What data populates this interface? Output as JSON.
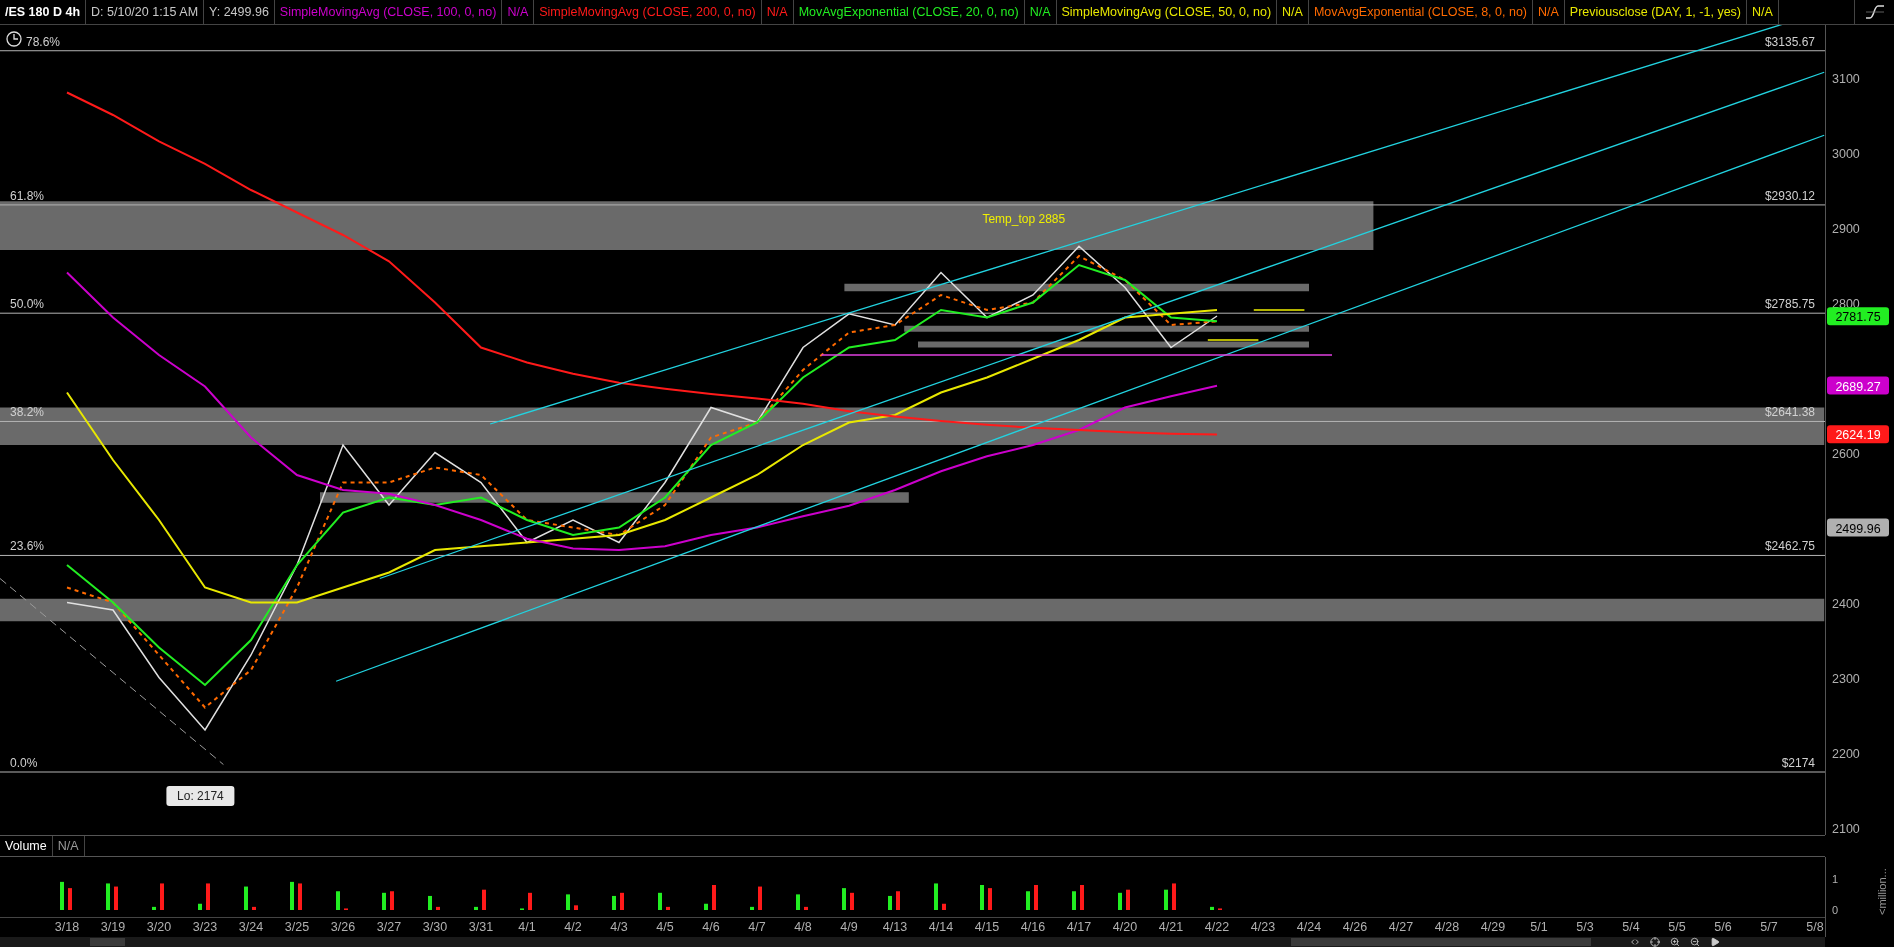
{
  "header": {
    "items": [
      {
        "kind": "symbol",
        "text": "/ES 180 D 4h"
      },
      {
        "kind": "info",
        "text": "D: 5/10/20 1:15 AM"
      },
      {
        "kind": "info",
        "text": "Y: 2499.96"
      },
      {
        "kind": "study",
        "text": "SimpleMovingAvg (CLOSE, 100, 0, no)",
        "color": "#cc00cc"
      },
      {
        "kind": "study",
        "text": "N/A",
        "color": "#cc00cc"
      },
      {
        "kind": "study",
        "text": "SimpleMovingAvg (CLOSE, 200, 0, no)",
        "color": "#ff1a1a"
      },
      {
        "kind": "study",
        "text": "N/A",
        "color": "#ff1a1a"
      },
      {
        "kind": "study",
        "text": "MovAvgExponential (CLOSE, 20, 0, no)",
        "color": "#22ee22"
      },
      {
        "kind": "study",
        "text": "N/A",
        "color": "#22ee22"
      },
      {
        "kind": "study",
        "text": "SimpleMovingAvg (CLOSE, 50, 0, no)",
        "color": "#e8e800"
      },
      {
        "kind": "study",
        "text": "N/A",
        "color": "#e8e800"
      },
      {
        "kind": "study",
        "text": "MovAvgExponential (CLOSE, 8, 0, no)",
        "color": "#ff6a00"
      },
      {
        "kind": "study",
        "text": "N/A",
        "color": "#ff6a00"
      },
      {
        "kind": "study",
        "text": "Previousclose (DAY, 1, -1, yes)",
        "color": "#e8e800"
      },
      {
        "kind": "study",
        "text": "N/A",
        "color": "#e8e800"
      }
    ]
  },
  "price_chart": {
    "levels": [
      {
        "left_label": "78.6%",
        "right_label": "$3135.67"
      },
      {
        "left_label": "61.8%",
        "right_label": "$2930.12"
      },
      {
        "left_label": "50.0%",
        "right_label": "$2785.75"
      },
      {
        "left_label": "38.2%",
        "right_label": "$2641.38"
      },
      {
        "left_label": "23.6%",
        "right_label": "$2462.75"
      },
      {
        "left_label": "0.0%",
        "right_label": "$2174"
      }
    ],
    "notes": [
      {
        "kind": "note",
        "text": "Temp_top 2885"
      },
      {
        "kind": "callout",
        "text": "Lo: 2174"
      }
    ],
    "price_tags": [
      {
        "text": "2781.75",
        "color": "#22ee22"
      },
      {
        "text": "2689.27",
        "color": "#cc00cc"
      },
      {
        "text": "2624.19",
        "color": "#ff1a1a"
      },
      {
        "text": "2499.96",
        "color": "#b0b0b0"
      }
    ],
    "chart_data": {
      "type": "line",
      "x": [
        "3/18",
        "3/19",
        "3/20",
        "3/23",
        "3/24",
        "3/25",
        "3/26",
        "3/27",
        "3/30",
        "3/31",
        "4/1",
        "4/2",
        "4/3",
        "4/5",
        "4/6",
        "4/7",
        "4/8",
        "4/9",
        "4/13",
        "4/14",
        "4/15",
        "4/16",
        "4/17",
        "4/20",
        "4/21",
        "4/22",
        "4/23",
        "4/24",
        "4/26",
        "4/27",
        "4/28",
        "4/29",
        "5/1",
        "5/3",
        "5/4",
        "5/5",
        "5/6",
        "5/7",
        "5/8"
      ],
      "ylim": [
        2090,
        3170
      ],
      "yticks": [
        2100,
        2200,
        2300,
        2400,
        2600,
        2800,
        2900,
        3000,
        3100
      ],
      "series": [
        {
          "color": "#e0e0e0",
          "values": [
            2400,
            2390,
            2300,
            2230,
            2330,
            2450,
            2610,
            2530,
            2600,
            2560,
            2480,
            2510,
            2480,
            2560,
            2660,
            2640,
            2740,
            2785,
            2770,
            2840,
            2780,
            2810,
            2875,
            2820,
            2740,
            2782,
            null,
            null,
            null,
            null,
            null,
            null,
            null,
            null,
            null,
            null,
            null,
            null,
            null
          ]
        },
        {
          "color": "#ff6a00",
          "line_style": "dashed",
          "values": [
            2420,
            2400,
            2330,
            2260,
            2310,
            2420,
            2560,
            2560,
            2580,
            2570,
            2510,
            2500,
            2490,
            2530,
            2620,
            2640,
            2710,
            2760,
            2770,
            2810,
            2790,
            2800,
            2862,
            2830,
            2770,
            2775,
            null,
            null,
            null,
            null,
            null,
            null,
            null,
            null,
            null,
            null,
            null,
            null,
            null
          ]
        },
        {
          "color": "#22ee22",
          "values": [
            2450,
            2400,
            2340,
            2290,
            2350,
            2450,
            2520,
            2540,
            2530,
            2540,
            2510,
            2490,
            2500,
            2540,
            2610,
            2640,
            2700,
            2740,
            2750,
            2790,
            2780,
            2800,
            2850,
            2830,
            2780,
            2775,
            null,
            null,
            null,
            null,
            null,
            null,
            null,
            null,
            null,
            null,
            null,
            null,
            null
          ]
        },
        {
          "color": "#e8e800",
          "values": [
            2680,
            2590,
            2510,
            2420,
            2400,
            2400,
            2420,
            2440,
            2470,
            2475,
            2480,
            2485,
            2490,
            2510,
            2540,
            2570,
            2610,
            2640,
            2650,
            2680,
            2700,
            2725,
            2750,
            2780,
            2785,
            2790,
            null,
            null,
            null,
            null,
            null,
            null,
            null,
            null,
            null,
            null,
            null,
            null,
            null
          ]
        },
        {
          "color": "#cc00cc",
          "values": [
            2840,
            2780,
            2730,
            2688,
            2620,
            2570,
            2550,
            2545,
            2530,
            2510,
            2485,
            2472,
            2470,
            2475,
            2490,
            2500,
            2515,
            2529,
            2550,
            2575,
            2595,
            2610,
            2630,
            2660,
            2675,
            2689,
            null,
            null,
            null,
            null,
            null,
            null,
            null,
            null,
            null,
            null,
            null,
            null,
            null
          ]
        },
        {
          "color": "#ff1a1a",
          "values": [
            3080,
            3050,
            3015,
            2985,
            2950,
            2920,
            2890,
            2855,
            2800,
            2740,
            2720,
            2705,
            2693,
            2685,
            2678,
            2672,
            2665,
            2655,
            2648,
            2642,
            2637,
            2633,
            2630,
            2627,
            2625,
            2624,
            null,
            null,
            null,
            null,
            null,
            null,
            null,
            null,
            null,
            null,
            null,
            null,
            null
          ]
        }
      ]
    }
  },
  "volume": {
    "title": "Volume",
    "status": "N/A",
    "chart_data": {
      "type": "bar",
      "ylabel": "<million...",
      "ylim": [
        0,
        1.6
      ],
      "yticks": [
        0,
        1
      ],
      "series": [
        {
          "color": "#22ee22",
          "values": [
            0.9,
            0.85,
            0.1,
            0.2,
            0.75,
            0.9,
            0.6,
            0.55,
            0.45,
            0.1,
            0.05,
            0.5,
            0.45,
            0.55,
            0.2,
            0.1,
            0.5,
            0.7,
            0.45,
            0.85,
            0.8,
            0.6,
            0.6,
            0.55,
            0.65,
            0.1,
            null,
            null,
            null,
            null,
            null,
            null,
            null,
            null,
            null,
            null,
            null,
            null,
            null
          ]
        },
        {
          "color": "#ff1a1a",
          "values": [
            0.7,
            0.75,
            0.85,
            0.85,
            0.1,
            0.85,
            0.05,
            0.6,
            0.1,
            0.65,
            0.55,
            0.15,
            0.55,
            0.1,
            0.8,
            0.75,
            0.1,
            0.55,
            0.6,
            0.2,
            0.7,
            0.8,
            0.8,
            0.65,
            0.85,
            0.05,
            null,
            null,
            null,
            null,
            null,
            null,
            null,
            null,
            null,
            null,
            null,
            null,
            null
          ]
        }
      ]
    }
  }
}
